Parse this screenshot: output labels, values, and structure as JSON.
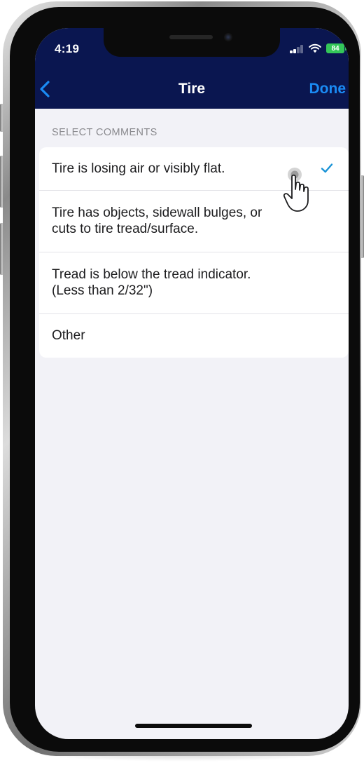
{
  "status_bar": {
    "time": "4:19",
    "battery_label": "84"
  },
  "nav_bar": {
    "title": "Tire",
    "done_label": "Done"
  },
  "section": {
    "header": "SELECT COMMENTS"
  },
  "comments": [
    {
      "line1": "Tire is losing air or visibly flat.",
      "line2": "",
      "selected": true
    },
    {
      "line1": "Tire has objects, sidewall bulges, or",
      "line2": "cuts to tire tread/surface.",
      "selected": false
    },
    {
      "line1": "Tread is below the tread indicator.",
      "line2": "(Less than 2/32\")",
      "selected": false
    },
    {
      "line1": "Other",
      "line2": "",
      "selected": false
    }
  ],
  "colors": {
    "nav_background": "#0a1650",
    "accent_blue": "#1a8bf5",
    "checkmark": "#1a93d6",
    "battery_green": "#34c759",
    "list_background": "#f2f2f7"
  },
  "icons": {
    "back": "chevron-left-icon",
    "selected": "checkmark-icon",
    "cursor": "hand-pointer-icon"
  }
}
